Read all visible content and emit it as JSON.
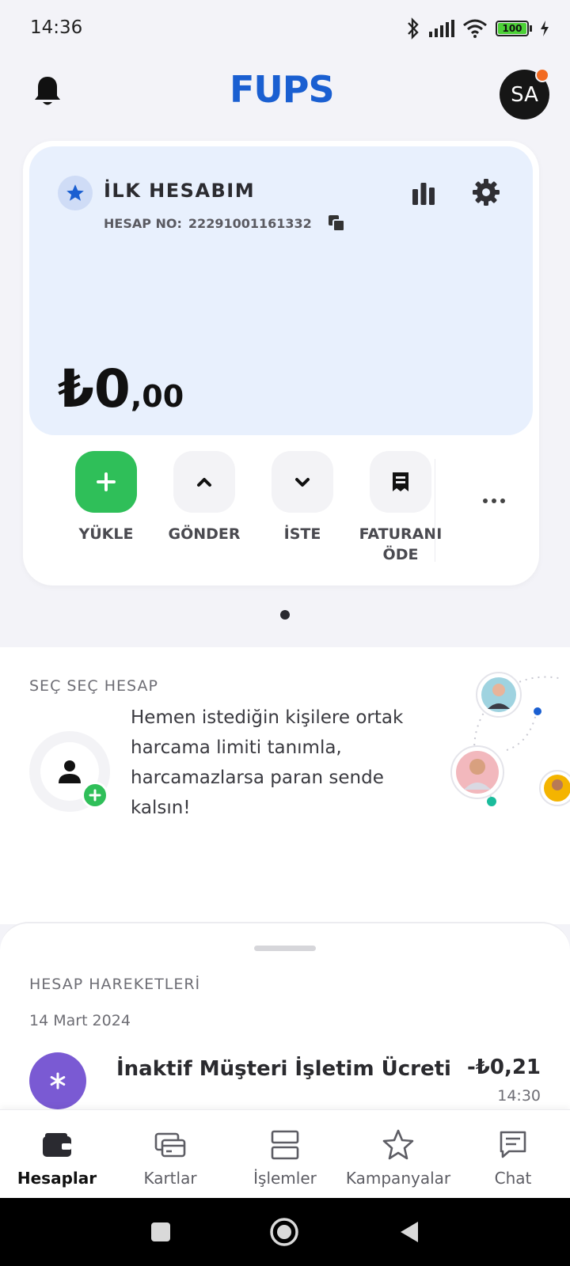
{
  "status_bar": {
    "time": "14:36",
    "battery": "100"
  },
  "header": {
    "logo": "FUPS",
    "avatar_initials": "SA"
  },
  "account": {
    "name": "İLK HESABIM",
    "number_label": "HESAP NO:",
    "number": "22291001161332",
    "balance_main": "₺0",
    "balance_decimals": ",00"
  },
  "actions": [
    {
      "label": "YÜKLE",
      "icon": "plus-icon"
    },
    {
      "label": "GÖNDER",
      "icon": "chevron-up-icon"
    },
    {
      "label": "İSTE",
      "icon": "chevron-down-icon"
    },
    {
      "label": "FATURANI ÖDE",
      "icon": "receipt-icon"
    }
  ],
  "promo": {
    "title": "SEÇ SEÇ HESAP",
    "text": "Hemen istediğin kişilere ortak harcama limiti tanımla, harcamazlarsa paran sende kalsın!"
  },
  "transactions": {
    "title": "HESAP HAREKETLERİ",
    "date": "14 Mart 2024",
    "items": [
      {
        "title": "İnaktif Müşteri İşletim Ücreti",
        "amount": "-₺0,21",
        "time": "14:30",
        "icon": "asterisk-icon"
      }
    ]
  },
  "tabs": [
    {
      "label": "Hesaplar",
      "icon": "wallet-icon",
      "active": true
    },
    {
      "label": "Kartlar",
      "icon": "cards-icon",
      "active": false
    },
    {
      "label": "İşlemler",
      "icon": "transactions-icon",
      "active": false
    },
    {
      "label": "Kampanyalar",
      "icon": "star-icon",
      "active": false
    },
    {
      "label": "Chat",
      "icon": "chat-icon",
      "active": false
    }
  ],
  "colors": {
    "brand": "#1a5fd1",
    "primary_action": "#2fbf59",
    "account_panel": "#e8f0fd",
    "transaction_icon": "#7a5ad3",
    "avatar_badge": "#f26a21"
  }
}
